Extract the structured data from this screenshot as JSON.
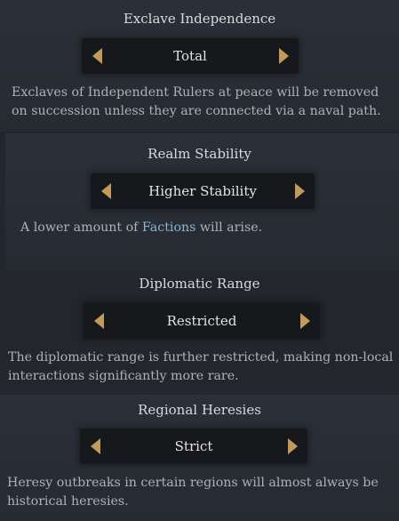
{
  "settings": [
    {
      "title": "Exclave Independence",
      "value": "Total",
      "description": "Exclaves of Independent Rulers at peace will be removed on succession unless they are connected via a naval path."
    },
    {
      "title": "Realm Stability",
      "value": "Higher Stability",
      "description_pre": "A lower amount of ",
      "description_link": "Factions",
      "description_post": " will arise."
    },
    {
      "title": "Diplomatic Range",
      "value": "Restricted",
      "description": "The diplomatic range is further restricted, making non-local interactions significantly more rare."
    },
    {
      "title": "Regional Heresies",
      "value": "Strict",
      "description": "Heresy outbreaks in certain regions will almost always be historical heresies."
    }
  ],
  "colors": {
    "arrow": "#c49a5c",
    "link": "#8fb3d6"
  },
  "icons": {
    "prev": "triangle-left-icon",
    "next": "triangle-right-icon"
  }
}
